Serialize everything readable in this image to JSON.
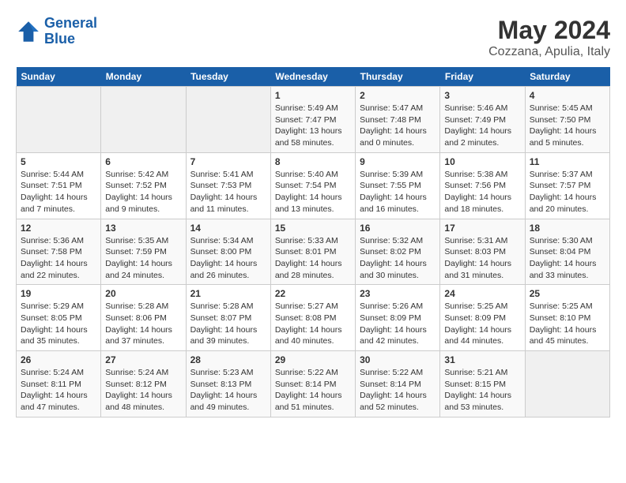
{
  "header": {
    "logo_line1": "General",
    "logo_line2": "Blue",
    "title": "May 2024",
    "subtitle": "Cozzana, Apulia, Italy"
  },
  "weekdays": [
    "Sunday",
    "Monday",
    "Tuesday",
    "Wednesday",
    "Thursday",
    "Friday",
    "Saturday"
  ],
  "weeks": [
    [
      {
        "day": "",
        "info": ""
      },
      {
        "day": "",
        "info": ""
      },
      {
        "day": "",
        "info": ""
      },
      {
        "day": "1",
        "info": "Sunrise: 5:49 AM\nSunset: 7:47 PM\nDaylight: 13 hours\nand 58 minutes."
      },
      {
        "day": "2",
        "info": "Sunrise: 5:47 AM\nSunset: 7:48 PM\nDaylight: 14 hours\nand 0 minutes."
      },
      {
        "day": "3",
        "info": "Sunrise: 5:46 AM\nSunset: 7:49 PM\nDaylight: 14 hours\nand 2 minutes."
      },
      {
        "day": "4",
        "info": "Sunrise: 5:45 AM\nSunset: 7:50 PM\nDaylight: 14 hours\nand 5 minutes."
      }
    ],
    [
      {
        "day": "5",
        "info": "Sunrise: 5:44 AM\nSunset: 7:51 PM\nDaylight: 14 hours\nand 7 minutes."
      },
      {
        "day": "6",
        "info": "Sunrise: 5:42 AM\nSunset: 7:52 PM\nDaylight: 14 hours\nand 9 minutes."
      },
      {
        "day": "7",
        "info": "Sunrise: 5:41 AM\nSunset: 7:53 PM\nDaylight: 14 hours\nand 11 minutes."
      },
      {
        "day": "8",
        "info": "Sunrise: 5:40 AM\nSunset: 7:54 PM\nDaylight: 14 hours\nand 13 minutes."
      },
      {
        "day": "9",
        "info": "Sunrise: 5:39 AM\nSunset: 7:55 PM\nDaylight: 14 hours\nand 16 minutes."
      },
      {
        "day": "10",
        "info": "Sunrise: 5:38 AM\nSunset: 7:56 PM\nDaylight: 14 hours\nand 18 minutes."
      },
      {
        "day": "11",
        "info": "Sunrise: 5:37 AM\nSunset: 7:57 PM\nDaylight: 14 hours\nand 20 minutes."
      }
    ],
    [
      {
        "day": "12",
        "info": "Sunrise: 5:36 AM\nSunset: 7:58 PM\nDaylight: 14 hours\nand 22 minutes."
      },
      {
        "day": "13",
        "info": "Sunrise: 5:35 AM\nSunset: 7:59 PM\nDaylight: 14 hours\nand 24 minutes."
      },
      {
        "day": "14",
        "info": "Sunrise: 5:34 AM\nSunset: 8:00 PM\nDaylight: 14 hours\nand 26 minutes."
      },
      {
        "day": "15",
        "info": "Sunrise: 5:33 AM\nSunset: 8:01 PM\nDaylight: 14 hours\nand 28 minutes."
      },
      {
        "day": "16",
        "info": "Sunrise: 5:32 AM\nSunset: 8:02 PM\nDaylight: 14 hours\nand 30 minutes."
      },
      {
        "day": "17",
        "info": "Sunrise: 5:31 AM\nSunset: 8:03 PM\nDaylight: 14 hours\nand 31 minutes."
      },
      {
        "day": "18",
        "info": "Sunrise: 5:30 AM\nSunset: 8:04 PM\nDaylight: 14 hours\nand 33 minutes."
      }
    ],
    [
      {
        "day": "19",
        "info": "Sunrise: 5:29 AM\nSunset: 8:05 PM\nDaylight: 14 hours\nand 35 minutes."
      },
      {
        "day": "20",
        "info": "Sunrise: 5:28 AM\nSunset: 8:06 PM\nDaylight: 14 hours\nand 37 minutes."
      },
      {
        "day": "21",
        "info": "Sunrise: 5:28 AM\nSunset: 8:07 PM\nDaylight: 14 hours\nand 39 minutes."
      },
      {
        "day": "22",
        "info": "Sunrise: 5:27 AM\nSunset: 8:08 PM\nDaylight: 14 hours\nand 40 minutes."
      },
      {
        "day": "23",
        "info": "Sunrise: 5:26 AM\nSunset: 8:09 PM\nDaylight: 14 hours\nand 42 minutes."
      },
      {
        "day": "24",
        "info": "Sunrise: 5:25 AM\nSunset: 8:09 PM\nDaylight: 14 hours\nand 44 minutes."
      },
      {
        "day": "25",
        "info": "Sunrise: 5:25 AM\nSunset: 8:10 PM\nDaylight: 14 hours\nand 45 minutes."
      }
    ],
    [
      {
        "day": "26",
        "info": "Sunrise: 5:24 AM\nSunset: 8:11 PM\nDaylight: 14 hours\nand 47 minutes."
      },
      {
        "day": "27",
        "info": "Sunrise: 5:24 AM\nSunset: 8:12 PM\nDaylight: 14 hours\nand 48 minutes."
      },
      {
        "day": "28",
        "info": "Sunrise: 5:23 AM\nSunset: 8:13 PM\nDaylight: 14 hours\nand 49 minutes."
      },
      {
        "day": "29",
        "info": "Sunrise: 5:22 AM\nSunset: 8:14 PM\nDaylight: 14 hours\nand 51 minutes."
      },
      {
        "day": "30",
        "info": "Sunrise: 5:22 AM\nSunset: 8:14 PM\nDaylight: 14 hours\nand 52 minutes."
      },
      {
        "day": "31",
        "info": "Sunrise: 5:21 AM\nSunset: 8:15 PM\nDaylight: 14 hours\nand 53 minutes."
      },
      {
        "day": "",
        "info": ""
      }
    ]
  ]
}
